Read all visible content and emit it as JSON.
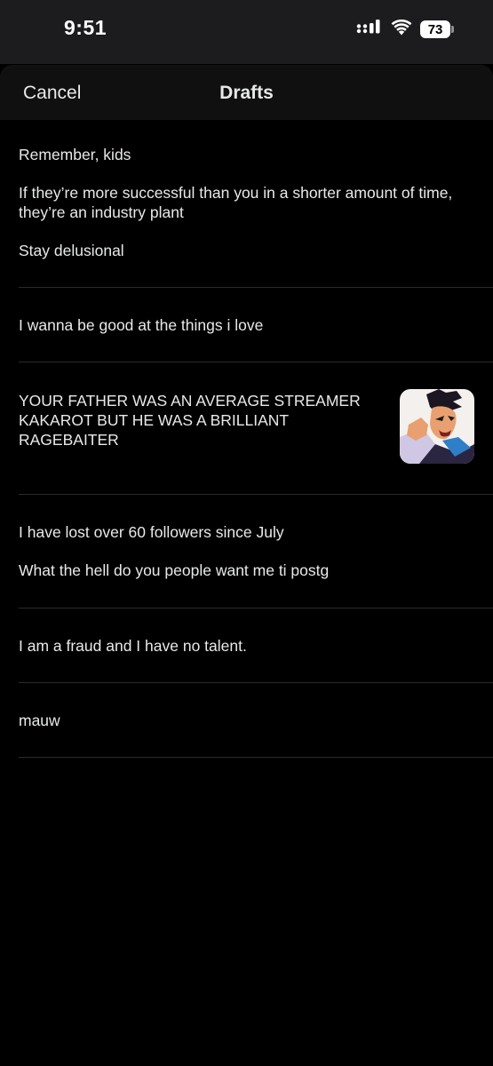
{
  "status_bar": {
    "time": "9:51",
    "battery_level": "73",
    "icons": [
      "cellular-signal-icon",
      "wifi-icon",
      "battery-icon"
    ]
  },
  "header": {
    "cancel_label": "Cancel",
    "title": "Drafts"
  },
  "drafts": [
    {
      "paragraphs": [
        "Remember, kids",
        "If they’re more successful than you in a shorter amount of time, they’re an industry plant",
        "Stay delusional"
      ]
    },
    {
      "paragraphs": [
        "I wanna be good at the things i love"
      ]
    },
    {
      "paragraphs": [
        "YOUR FATHER WAS AN AVERAGE STREAMER KAKAROT BUT HE WAS A BRILLIANT RAGEBAITER"
      ],
      "has_image": true
    },
    {
      "paragraphs": [
        "I have lost over 60 followers since July",
        "What the hell do you people want me ti postg"
      ]
    },
    {
      "paragraphs": [
        "I am a fraud and I have no talent."
      ]
    },
    {
      "paragraphs": [
        "mauw"
      ]
    }
  ],
  "colors": {
    "background": "#000000",
    "text": "#e7e9ea",
    "divider": "#2a2a2a",
    "header_bg": "#101010",
    "status_bg": "#1c1c1e"
  }
}
